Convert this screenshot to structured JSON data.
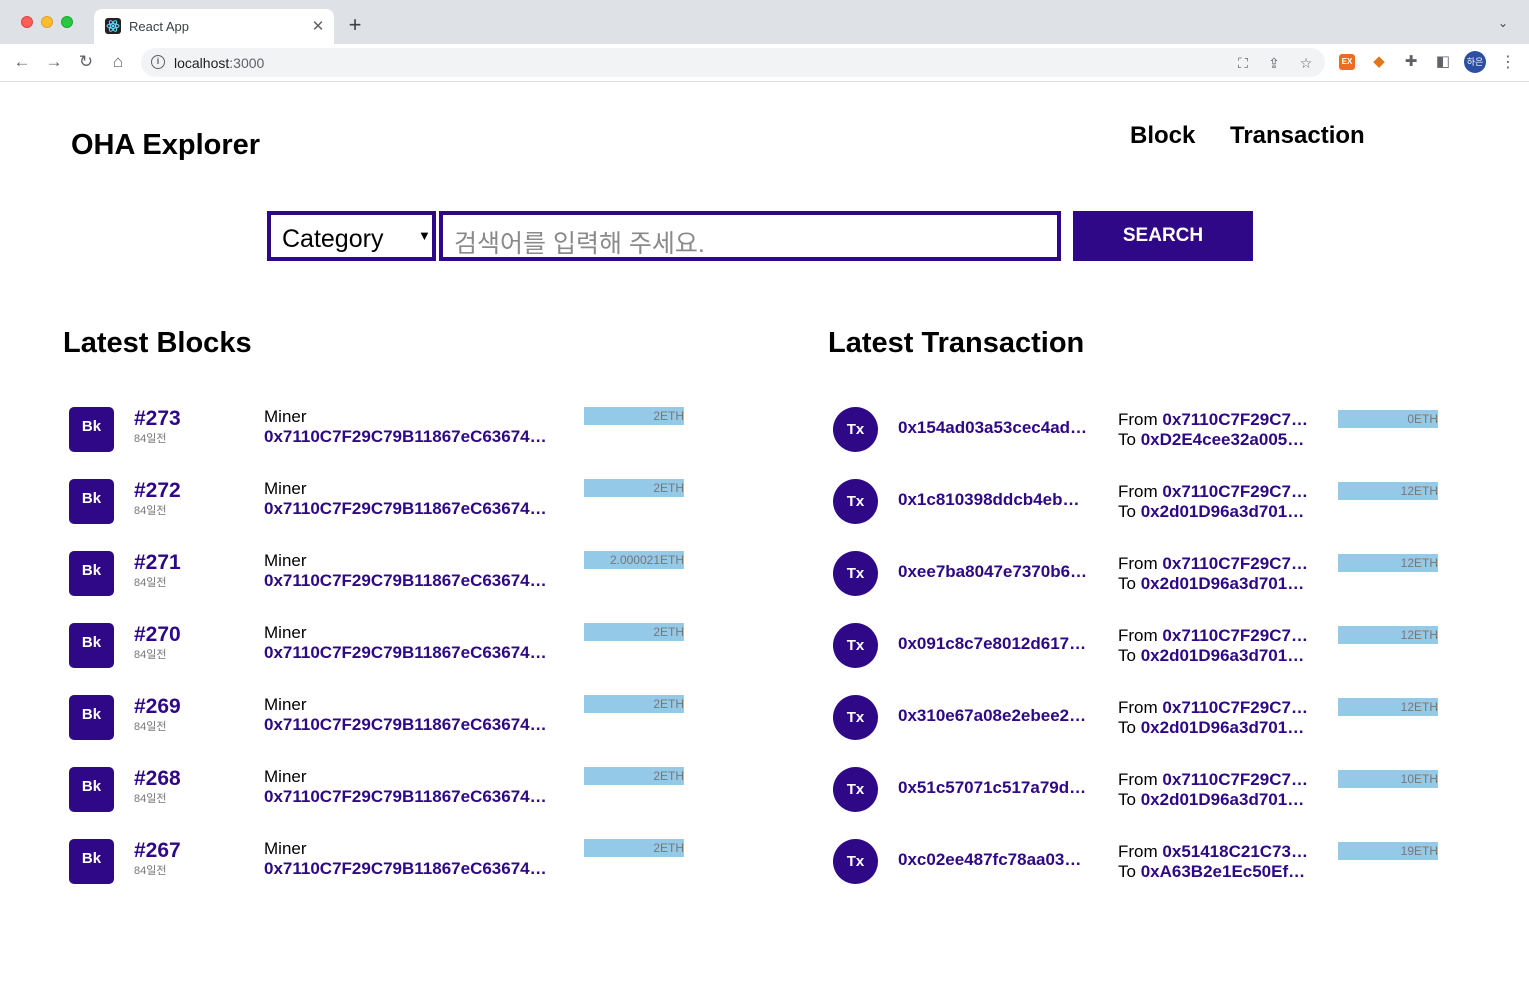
{
  "browser": {
    "tab_title": "React App",
    "url_host": "localhost",
    "url_port": ":3000",
    "avatar_label": "하은"
  },
  "header": {
    "logo": "OHA Explorer",
    "nav": [
      "Block",
      "Transaction"
    ]
  },
  "search": {
    "category_label": "Category",
    "placeholder": "검색어를 입력해 주세요.",
    "button_label": "SEARCH"
  },
  "blocks": {
    "title": "Latest Blocks",
    "badge": "Bk",
    "miner_label": "Miner",
    "items": [
      {
        "number": "#273",
        "age": "84일전",
        "miner": "0x7110C7F29C79B11867eC63674…",
        "reward": "2ETH"
      },
      {
        "number": "#272",
        "age": "84일전",
        "miner": "0x7110C7F29C79B11867eC63674…",
        "reward": "2ETH"
      },
      {
        "number": "#271",
        "age": "84일전",
        "miner": "0x7110C7F29C79B11867eC63674…",
        "reward": "2.000021ETH"
      },
      {
        "number": "#270",
        "age": "84일전",
        "miner": "0x7110C7F29C79B11867eC63674…",
        "reward": "2ETH"
      },
      {
        "number": "#269",
        "age": "84일전",
        "miner": "0x7110C7F29C79B11867eC63674…",
        "reward": "2ETH"
      },
      {
        "number": "#268",
        "age": "84일전",
        "miner": "0x7110C7F29C79B11867eC63674…",
        "reward": "2ETH"
      },
      {
        "number": "#267",
        "age": "84일전",
        "miner": "0x7110C7F29C79B11867eC63674…",
        "reward": "2ETH"
      }
    ]
  },
  "transactions": {
    "title": "Latest Transaction",
    "badge": "Tx",
    "from_label": "From",
    "to_label": "To",
    "items": [
      {
        "hash": "0x154ad03a53cec4ad…",
        "from": "0x7110C7F29C7…",
        "to": "0xD2E4cee32a005…",
        "value": "0ETH"
      },
      {
        "hash": "0x1c810398ddcb4eb…",
        "from": "0x7110C7F29C7…",
        "to": "0x2d01D96a3d701…",
        "value": "12ETH"
      },
      {
        "hash": "0xee7ba8047e7370b6…",
        "from": "0x7110C7F29C7…",
        "to": "0x2d01D96a3d701…",
        "value": "12ETH"
      },
      {
        "hash": "0x091c8c7e8012d617…",
        "from": "0x7110C7F29C7…",
        "to": "0x2d01D96a3d701…",
        "value": "12ETH"
      },
      {
        "hash": "0x310e67a08e2ebee2…",
        "from": "0x7110C7F29C7…",
        "to": "0x2d01D96a3d701…",
        "value": "12ETH"
      },
      {
        "hash": "0x51c57071c517a79d…",
        "from": "0x7110C7F29C7…",
        "to": "0x2d01D96a3d701…",
        "value": "10ETH"
      },
      {
        "hash": "0xc02ee487fc78aa03…",
        "from": "0x51418C21C73…",
        "to": "0xA63B2e1Ec50Ef…",
        "value": "19ETH"
      }
    ]
  },
  "theme": {
    "primary": "#2e0887",
    "value_bar": "#95c9e8"
  }
}
